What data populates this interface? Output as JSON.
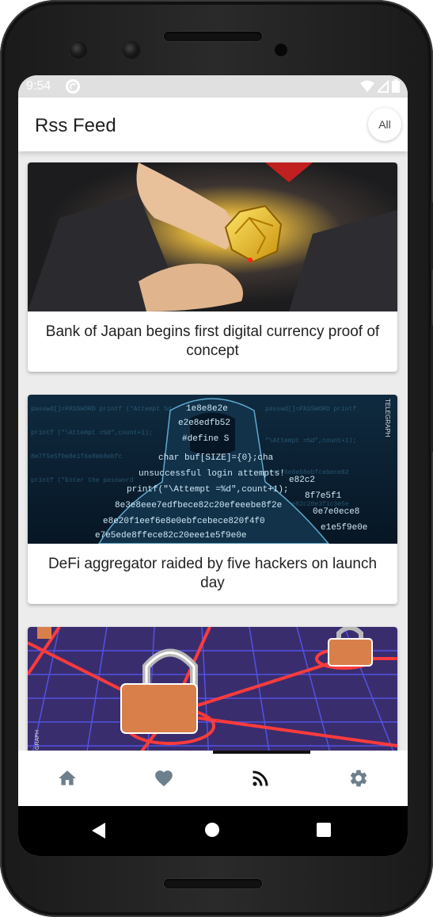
{
  "status_bar": {
    "time": "9:54",
    "icons": [
      "sync-icon",
      "wifi-icon",
      "signal-icon",
      "battery-icon"
    ]
  },
  "app_bar": {
    "title": "Rss Feed",
    "filter_button_label": "All"
  },
  "feed": {
    "items": [
      {
        "title": "Bank of Japan begins first digital currency proof of concept",
        "image": "digital-coin-illustration"
      },
      {
        "title": "DeFi aggregator raided by five hackers on launch day",
        "image": "hooded-hacker-code-illustration",
        "image_watermark": "TELEGRAPH"
      },
      {
        "title": "",
        "image": "padlock-network-grid-illustration",
        "image_watermark": "GRAPH"
      }
    ]
  },
  "bottom_nav": {
    "items": [
      {
        "name": "home",
        "icon": "home-icon",
        "active": false
      },
      {
        "name": "favorites",
        "icon": "heart-icon",
        "active": false
      },
      {
        "name": "rss",
        "icon": "rss-icon",
        "active": true
      },
      {
        "name": "settings",
        "icon": "gear-icon",
        "active": false
      }
    ]
  },
  "colors": {
    "statusbar_bg": "#e0e0e0",
    "feed_bg": "#ececec",
    "nav_inactive": "#6d7f8c",
    "nav_active": "#111111",
    "indicator": "#111111"
  }
}
